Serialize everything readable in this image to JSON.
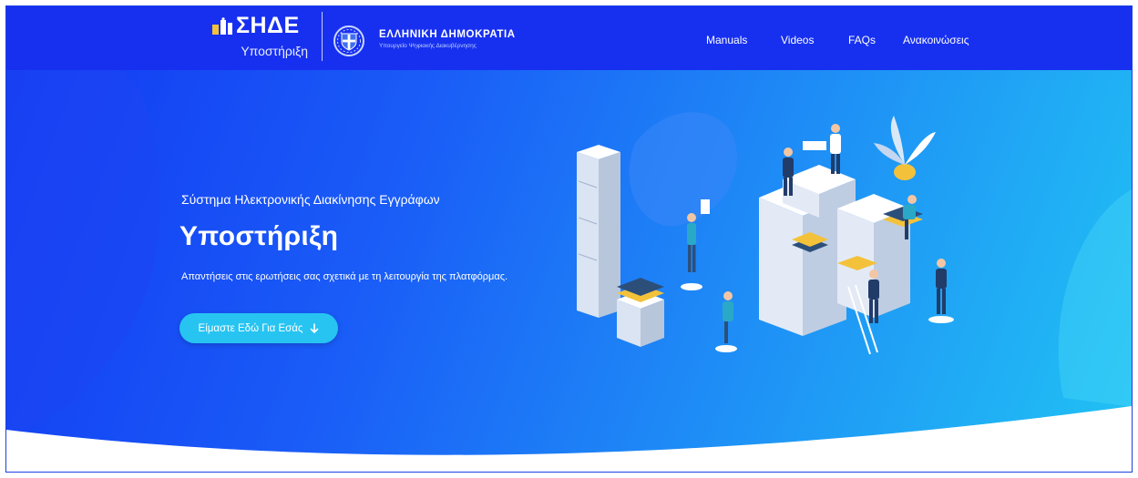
{
  "header": {
    "brand_name": "ΣΗΔΕ",
    "brand_subtitle": "Υποστήριξη",
    "gov_title": "ΕΛΛΗΝΙΚΗ ΔΗΜΟΚΡΑΤΙΑ",
    "gov_subtitle": "Υπουργείο Ψηφιακής Διακυβέρνησης",
    "nav": [
      {
        "label": "Manuals"
      },
      {
        "label": "Videos"
      },
      {
        "label": "FAQs"
      },
      {
        "label": "Ανακοινώσεις"
      }
    ]
  },
  "hero": {
    "subtitle": "Σύστημα Ηλεκτρονικής Διακίνησης Εγγράφων",
    "title": "Υποστήριξη",
    "description": "Απαντήσεις στις ερωτήσεις σας σχετικά με τη λειτουργία της πλατφόρμας.",
    "cta_label": "Είμαστε Εδώ Για Εσάς"
  },
  "colors": {
    "topbar": "#1730f0",
    "gradient_start": "#1238f2",
    "gradient_end": "#21c3f4",
    "cta": "#27c4f2",
    "folder_yellow": "#f3c23a"
  },
  "icons": {
    "brand_mark": "papers-icon",
    "gov_emblem": "greek-coat-of-arms-icon",
    "cta_arrow": "arrow-down-icon"
  }
}
